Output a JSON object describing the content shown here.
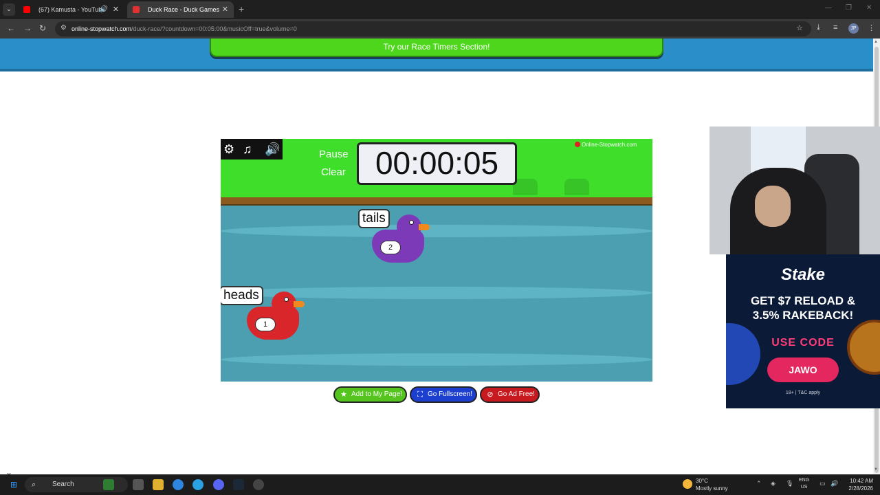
{
  "browser": {
    "tabs": [
      {
        "title": "(67) Kamusta - YouTube",
        "favicon_color": "#ff0000",
        "active": false
      },
      {
        "title": "Duck Race - Duck Games",
        "favicon_color": "#e03030",
        "active": true
      }
    ],
    "url_host": "online-stopwatch.com",
    "url_path": "/duck-race/?countdown=00:05:00&musicOff=true&volume=0",
    "profile_initials": "JP"
  },
  "page": {
    "banner_button": "Try our Race Timers Section!",
    "game": {
      "pause_label": "Pause",
      "clear_label": "Clear",
      "timer": "00:00:05",
      "logo_text": "Online-Stopwatch.com",
      "ducks": [
        {
          "label": "tails",
          "number": "2",
          "color": "#7d3ab8"
        },
        {
          "label": "heads",
          "number": "1",
          "color": "#d8262a"
        }
      ]
    },
    "actions": {
      "add": "Add to My Page!",
      "fullscreen": "Go Fullscreen!",
      "adfree": "Go Ad Free!"
    },
    "ad": {
      "brand": "Stake",
      "headline1": "GET $7 RELOAD &",
      "headline2": "3.5% RAKEBACK!",
      "use_code": "USE CODE",
      "code": "JAWO",
      "fine_print": "18+ | T&C apply"
    }
  },
  "taskbar": {
    "search_placeholder": "Search",
    "weather_temp": "30°C",
    "weather_desc": "Mostly sunny",
    "lang1": "ENG",
    "lang2": "US",
    "time": "10:42 AM",
    "date": "2/28/2026"
  },
  "colors": {
    "grass": "#3fde2b",
    "water": "#4b9fb0",
    "banner_green": "#4dd61b",
    "banner_blue": "#2a8fc8",
    "add_btn": "#55c41f",
    "fullscreen_btn": "#1c3fd0",
    "adfree_btn": "#c8191f"
  }
}
